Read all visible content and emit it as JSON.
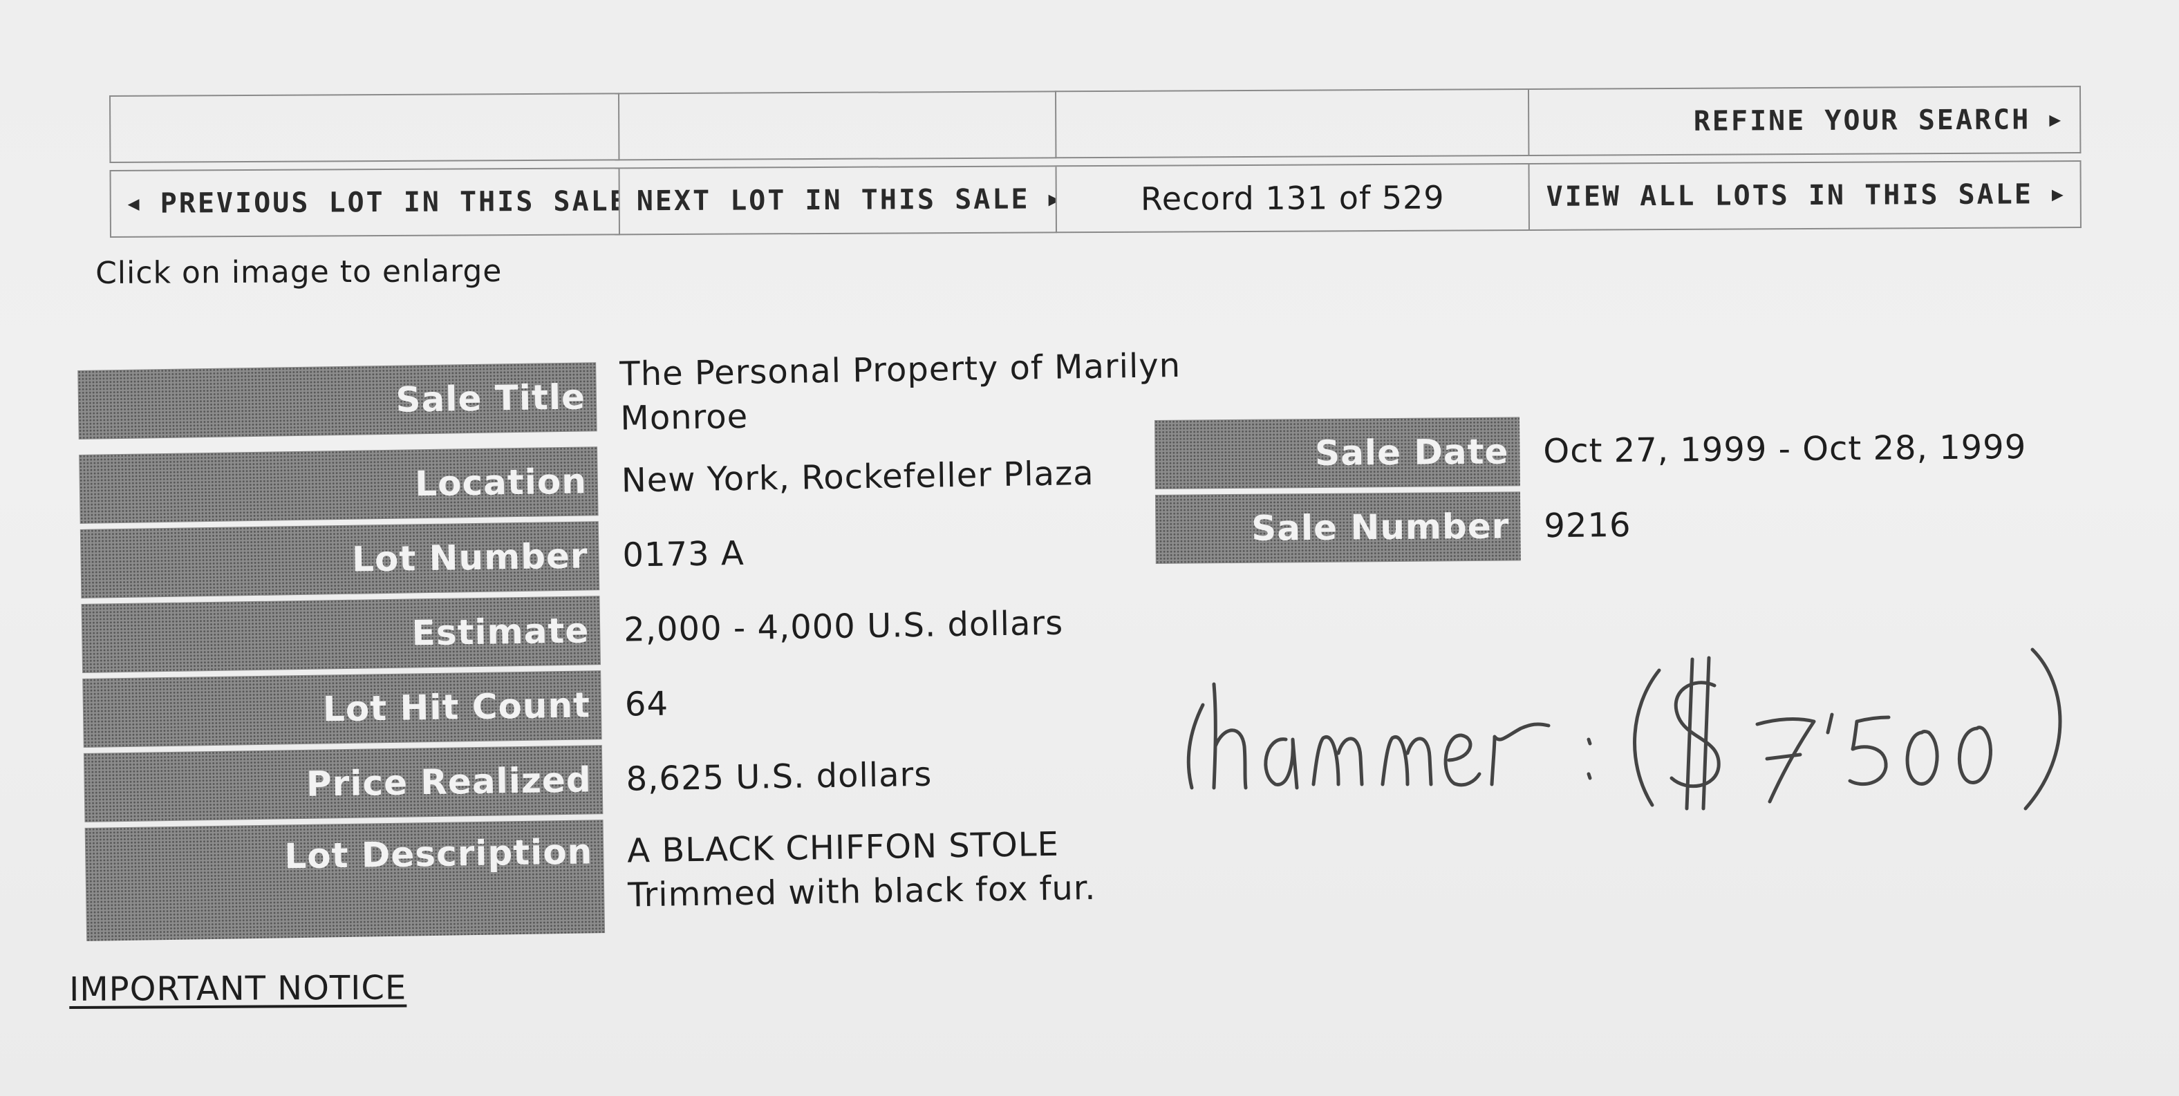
{
  "nav": {
    "refine": "REFINE YOUR SEARCH",
    "previous": "PREVIOUS LOT IN THIS SALE",
    "next": "NEXT LOT IN THIS SALE",
    "record": "Record 131 of 529",
    "view_all": "VIEW ALL LOTS IN THIS SALE",
    "arrow_left": "◀",
    "arrow_right": "▶"
  },
  "hint": "Click on image to enlarge",
  "details": [
    {
      "label": "Sale Title",
      "value": "The Personal Property of Marilyn Monroe"
    },
    {
      "label": "Location",
      "value": "New York, Rockefeller Plaza"
    },
    {
      "label": "Lot Number",
      "value": "0173 A"
    },
    {
      "label": "Estimate",
      "value": "2,000 - 4,000 U.S. dollars"
    },
    {
      "label": "Lot Hit Count",
      "value": "64"
    },
    {
      "label": "Price Realized",
      "value": "8,625 U.S. dollars"
    },
    {
      "label": "Lot Description",
      "value": "A BLACK CHIFFON STOLE",
      "value2": "Trimmed with black fox fur."
    }
  ],
  "sale_info": [
    {
      "label": "Sale Date",
      "value": "Oct 27, 1999 - Oct 28, 1999"
    },
    {
      "label": "Sale Number",
      "value": "9216"
    }
  ],
  "handwritten_note": "(hammer: $7'500)",
  "important_notice": "IMPORTANT NOTICE"
}
